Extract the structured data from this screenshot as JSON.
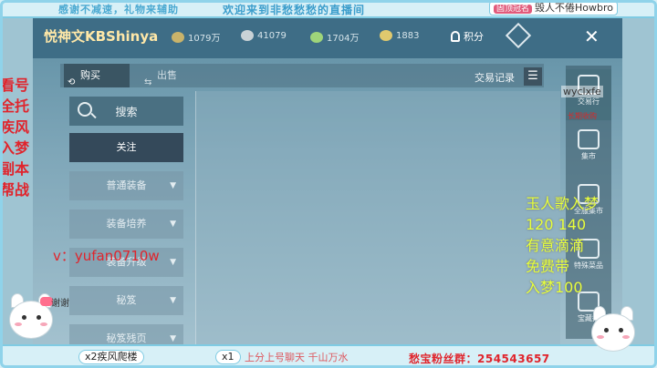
{
  "stream": {
    "top_left_text": "感谢不减速，礼物来辅助",
    "top_center_text": "欢迎来到非愁愁愁的直播间",
    "top_right_tag": "固顶冠名",
    "top_right_name": "毁人不倦Howbro",
    "left_promo": [
      "看号",
      "全托",
      "疾风",
      "入梦",
      "副本",
      "帮战"
    ],
    "wechat_line": "v：yufan0710w",
    "right_promo": [
      "玉人歌入梦",
      "120 140",
      "有意滴滴",
      "免费带",
      "入梦100"
    ],
    "overlay_name": "wyclxfe",
    "overlay_small": "长期收购",
    "bottom_gift1": "x2疾风爬楼",
    "bottom_gift2": "x1",
    "bottom_scroll": "上分上号聊天 千山万水",
    "bottom_fans": "愁宝粉丝群：254543657",
    "mascot_text": "谢谢"
  },
  "header": {
    "title": "悦神文KBShinya",
    "currencies": [
      {
        "icon": "coin-icon",
        "value": "1079万",
        "color": "#c9b36a"
      },
      {
        "icon": "silver-icon",
        "value": "41079",
        "color": "#c9d2d6"
      },
      {
        "icon": "leaf-icon",
        "value": "1704万",
        "color": "#9fd57a"
      },
      {
        "icon": "ingot-icon",
        "value": "1883",
        "color": "#e0c96e"
      }
    ],
    "points_label": "积分",
    "close_glyph": "✕"
  },
  "tabs": {
    "buy": "购买",
    "sell": "出售",
    "records": "交易记录",
    "list_glyph": "☰"
  },
  "sidebar": {
    "search": "搜索",
    "items": [
      {
        "label": "关注",
        "active": true
      },
      {
        "label": "普通装备",
        "active": false
      },
      {
        "label": "装备培养",
        "active": false
      },
      {
        "label": "装备升级",
        "active": false
      },
      {
        "label": "秘笈",
        "active": false
      },
      {
        "label": "秘笈残页",
        "active": false
      }
    ],
    "chevron": "▼"
  },
  "right_rail": [
    {
      "label": "交易行",
      "active": true
    },
    {
      "label": "集市",
      "active": false
    },
    {
      "label": "全服集市",
      "active": false
    },
    {
      "label": "特殊菜品",
      "active": false
    },
    {
      "label": "宝藏拍",
      "active": false
    }
  ]
}
